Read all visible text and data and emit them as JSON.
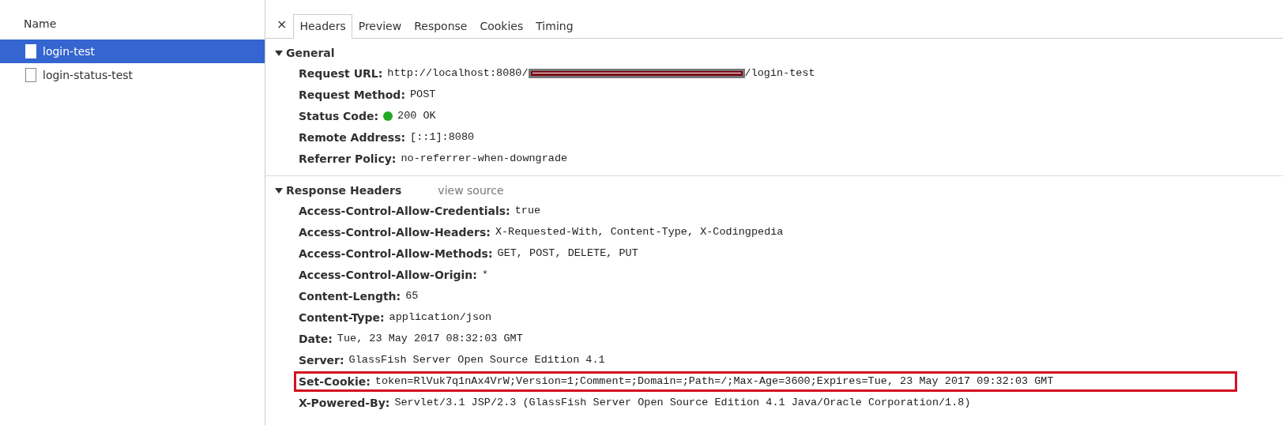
{
  "requests": {
    "header": "Name",
    "items": [
      {
        "name": "login-test",
        "selected": true
      },
      {
        "name": "login-status-test",
        "selected": false
      }
    ]
  },
  "close": "×",
  "tabs": [
    {
      "label": "Headers",
      "selected": true
    },
    {
      "label": "Preview",
      "selected": false
    },
    {
      "label": "Response",
      "selected": false
    },
    {
      "label": "Cookies",
      "selected": false
    },
    {
      "label": "Timing",
      "selected": false
    }
  ],
  "general": {
    "title": "General",
    "expanded": true,
    "rows": [
      {
        "kind": "url",
        "name": "Request URL:",
        "value": "http://localhost:8080/",
        "value_after": "/login-test"
      },
      {
        "kind": "text",
        "name": "Request Method:",
        "value": "POST"
      },
      {
        "kind": "status",
        "name": "Status Code:",
        "value": "200 OK",
        "color": "#22aa22"
      },
      {
        "kind": "text",
        "name": "Remote Address:",
        "value": "[::1]:8080"
      },
      {
        "kind": "text",
        "name": "Referrer Policy:",
        "value": "no-referrer-when-downgrade"
      }
    ]
  },
  "response_headers": {
    "title": "Response Headers",
    "expanded": true,
    "link": "view source",
    "rows": [
      {
        "name": "Access-Control-Allow-Credentials:",
        "value": "true",
        "highlighted": false
      },
      {
        "name": "Access-Control-Allow-Headers:",
        "value": "X-Requested-With, Content-Type, X-Codingpedia",
        "highlighted": false
      },
      {
        "name": "Access-Control-Allow-Methods:",
        "value": "GET, POST, DELETE, PUT",
        "highlighted": false
      },
      {
        "name": "Access-Control-Allow-Origin:",
        "value": "*",
        "highlighted": false
      },
      {
        "name": "Content-Length:",
        "value": "65",
        "highlighted": false
      },
      {
        "name": "Content-Type:",
        "value": "application/json",
        "highlighted": false
      },
      {
        "name": "Date:",
        "value": "Tue, 23 May 2017 08:32:03 GMT",
        "highlighted": false
      },
      {
        "name": "Server:",
        "value": "GlassFish Server Open Source Edition  4.1",
        "highlighted": false
      },
      {
        "name": "Set-Cookie:",
        "value": "token=RlVuk7q1nAx4VrW;Version=1;Comment=;Domain=;Path=/;Max-Age=3600;Expires=Tue, 23 May 2017 09:32:03 GMT",
        "highlighted": true
      },
      {
        "name": "X-Powered-By:",
        "value": "Servlet/3.1 JSP/2.3 (GlassFish Server Open Source Edition  4.1  Java/Oracle Corporation/1.8)",
        "highlighted": false
      }
    ]
  }
}
